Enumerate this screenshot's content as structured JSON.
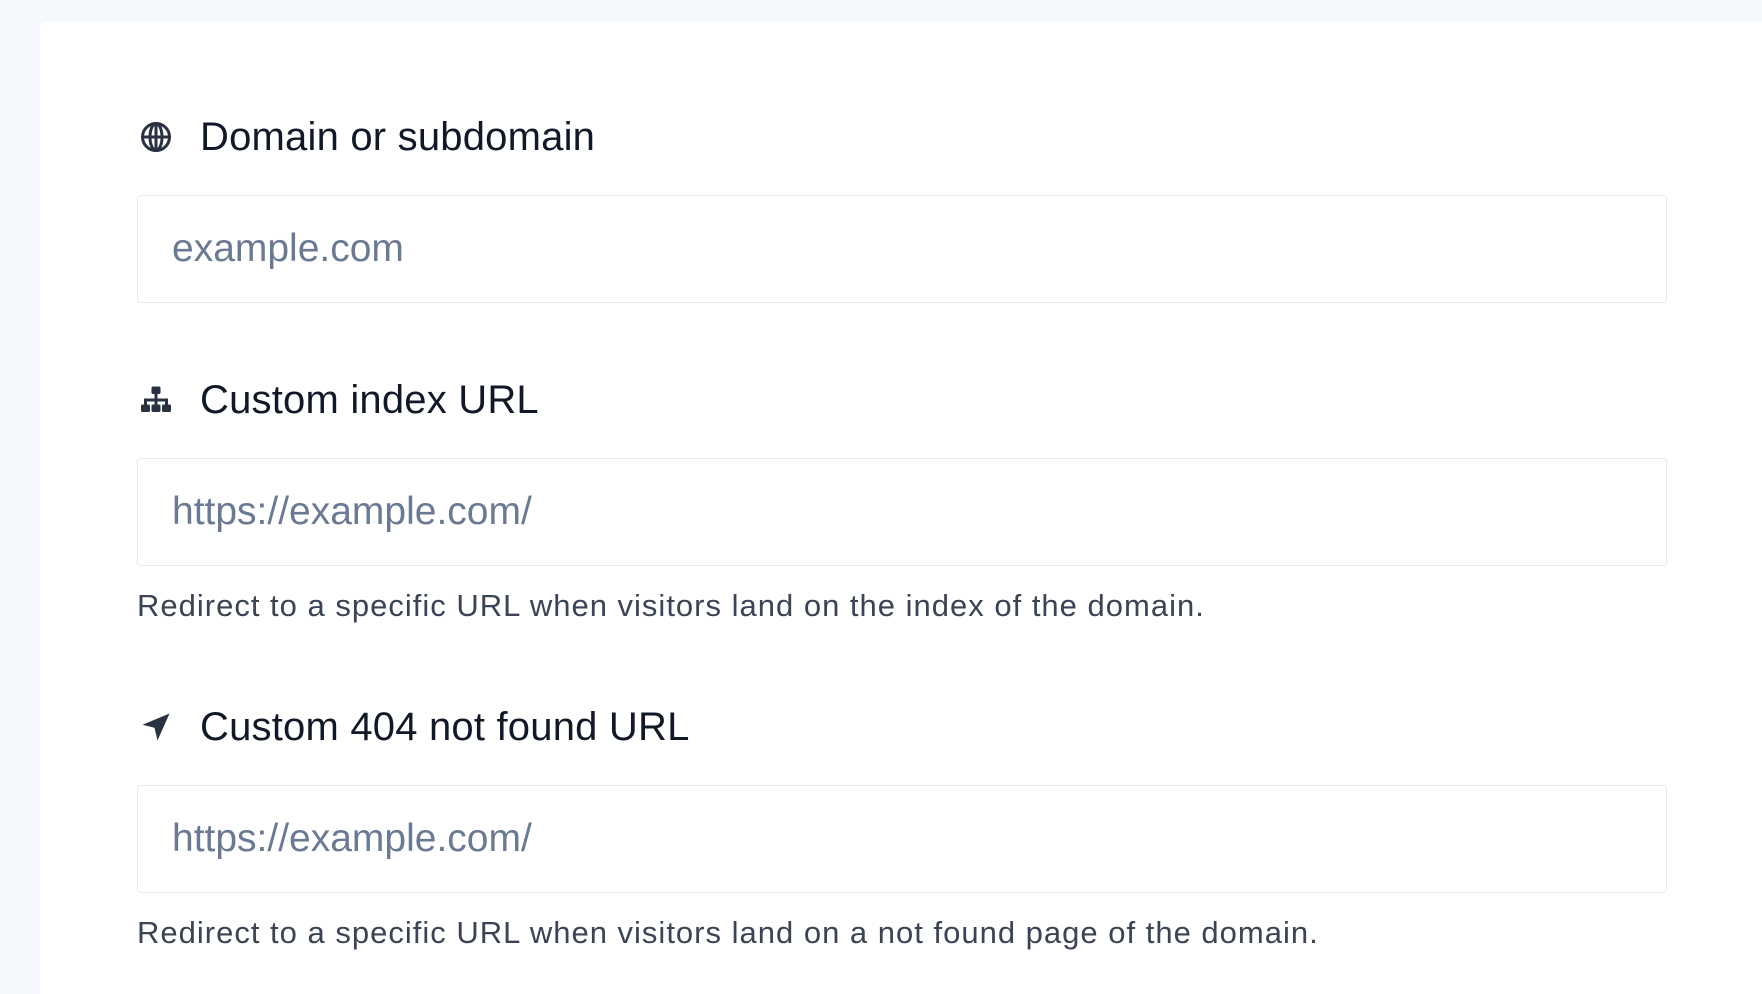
{
  "fields": [
    {
      "label": "Domain or subdomain",
      "icon": "globe-icon",
      "placeholder": "example.com",
      "value": "",
      "help": ""
    },
    {
      "label": "Custom index URL",
      "icon": "sitemap-icon",
      "placeholder": "https://example.com/",
      "value": "",
      "help": "Redirect to a specific URL when visitors land on the index of the domain."
    },
    {
      "label": "Custom 404 not found URL",
      "icon": "location-arrow-icon",
      "placeholder": "https://example.com/",
      "value": "",
      "help": "Redirect to a specific URL when visitors land on a not found page of the domain."
    }
  ],
  "colors": {
    "background": "#f5f8fc",
    "card": "#ffffff",
    "label": "#111827",
    "placeholder": "#6b7a93",
    "border": "#e6eaf0"
  }
}
